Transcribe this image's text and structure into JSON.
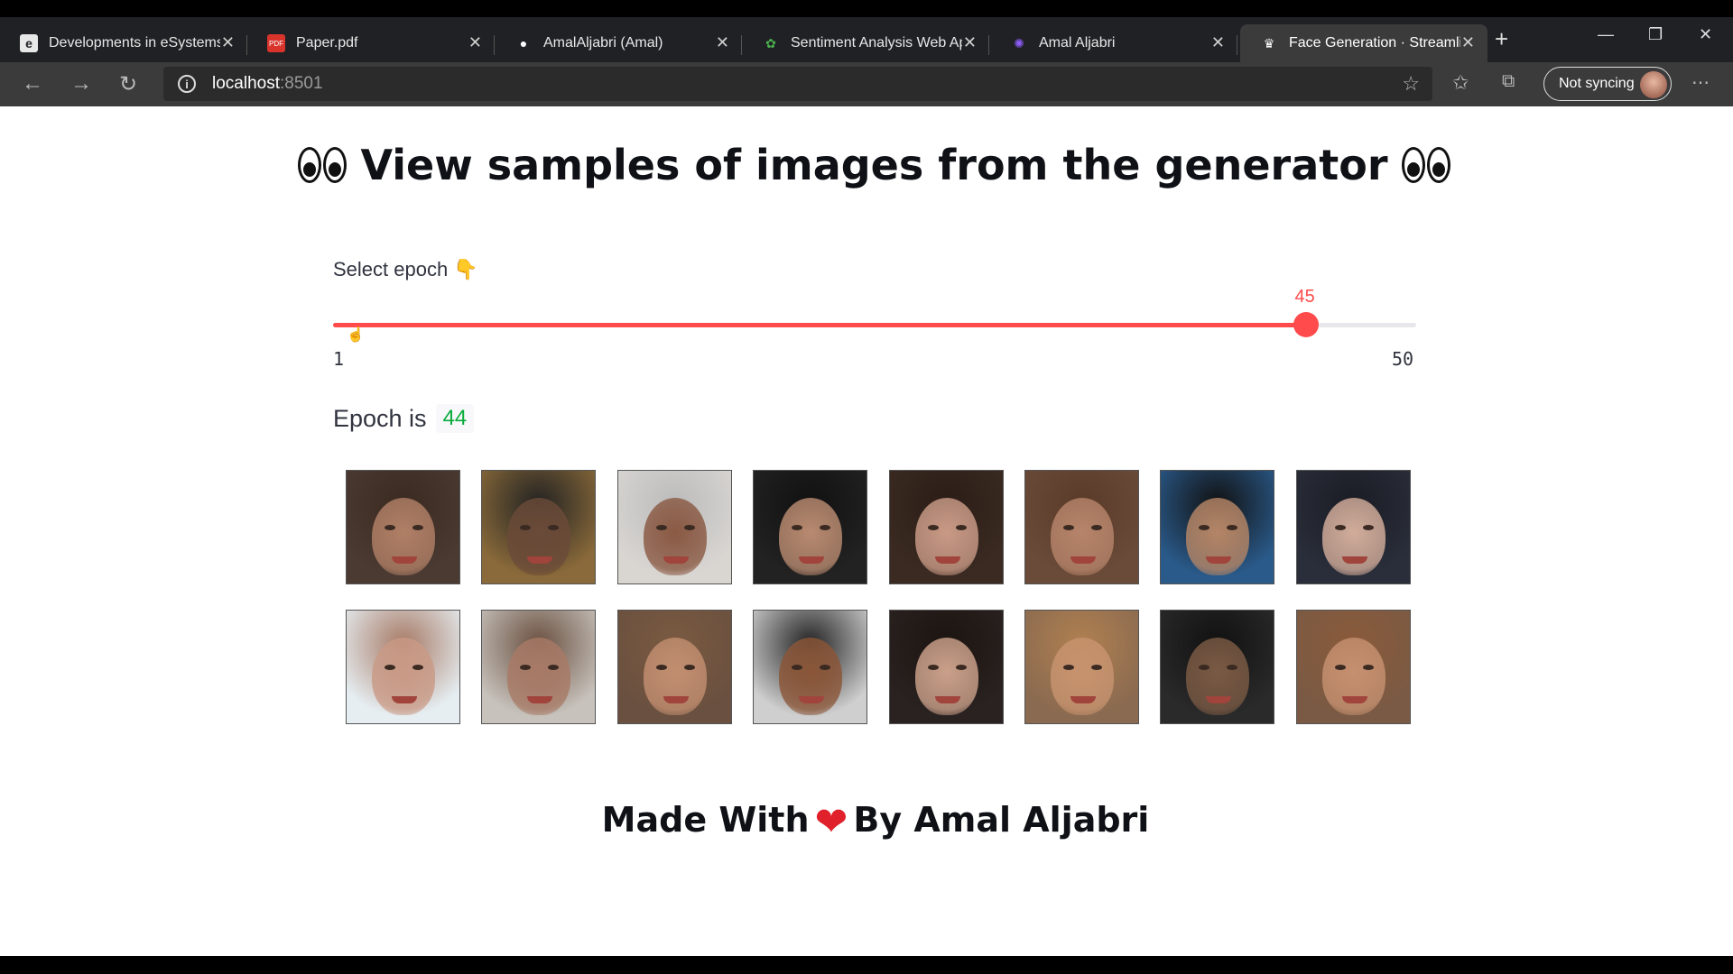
{
  "browser": {
    "tabs": [
      {
        "title": "Developments in eSystems E",
        "favicon": "e-icon",
        "favicon_text": "e",
        "favicon_color": "#e8e8e8",
        "active": false
      },
      {
        "title": "Paper.pdf",
        "favicon": "pdf-icon",
        "favicon_text": "PDF",
        "favicon_color": "#d9342b",
        "active": false
      },
      {
        "title": "AmalAljabri (Amal)",
        "favicon": "github-icon",
        "favicon_text": "●",
        "favicon_color": "#ffffff",
        "active": false
      },
      {
        "title": "Sentiment Analysis Web App",
        "favicon": "sentiment-icon",
        "favicon_text": "✿",
        "favicon_color": "#4caf50",
        "active": false
      },
      {
        "title": "Amal Aljabri",
        "favicon": "sparkle-icon",
        "favicon_text": "✺",
        "favicon_color": "#8b5cf6",
        "active": false
      },
      {
        "title": "Face Generation · Streamlit",
        "favicon": "streamlit-icon",
        "favicon_text": "♛",
        "favicon_color": "#ffffff",
        "active": true
      }
    ],
    "url_host": "localhost",
    "url_port": ":8501",
    "sync_label": "Not syncing"
  },
  "page": {
    "heading": "View samples of images from the generator",
    "slider": {
      "label": "Select epoch 👇",
      "value": 45,
      "min": 1,
      "max": 50,
      "accent": "#ff4b4b"
    },
    "epoch_prefix": "Epoch is",
    "epoch_value": "44",
    "images": [
      {
        "bg": "#4a3a32",
        "skin": "#b07f66",
        "hair": "#3b2a20"
      },
      {
        "bg": "#8a6a3a",
        "skin": "#6a4a38",
        "hair": "#222"
      },
      {
        "bg": "#d9d6d2",
        "skin": "#8a5a44",
        "hair": "#bbb"
      },
      {
        "bg": "#222",
        "skin": "#b88a70",
        "hair": "#111"
      },
      {
        "bg": "#3a2a22",
        "skin": "#c99a86",
        "hair": "#2b1d16"
      },
      {
        "bg": "#6a4a38",
        "skin": "#b6846a",
        "hair": "#5a3a28"
      },
      {
        "bg": "#2a5a8a",
        "skin": "#b48566",
        "hair": "#111"
      },
      {
        "bg": "#2a2e3a",
        "skin": "#d1ac9a",
        "hair": "#1a1c24"
      },
      {
        "bg": "#e6eef2",
        "skin": "#c99a86",
        "hair": "#a77a66"
      },
      {
        "bg": "#c7c2bc",
        "skin": "#a77a66",
        "hair": "#6a5040"
      },
      {
        "bg": "#6a5040",
        "skin": "#c28e70",
        "hair": "#7a5a40"
      },
      {
        "bg": "#cfcfcf",
        "skin": "#8a5638",
        "hair": "#222"
      },
      {
        "bg": "#2a2220",
        "skin": "#caa08a",
        "hair": "#1c1410"
      },
      {
        "bg": "#8a6a50",
        "skin": "#c7936f",
        "hair": "#b08050"
      },
      {
        "bg": "#2a2a2a",
        "skin": "#7a5a44",
        "hair": "#111"
      },
      {
        "bg": "#7a5a44",
        "skin": "#c59070",
        "hair": "#8a5a3a"
      }
    ],
    "footer": {
      "before": "Made With",
      "heart_icon": "heart-icon",
      "after": "By Amal Aljabri"
    }
  }
}
